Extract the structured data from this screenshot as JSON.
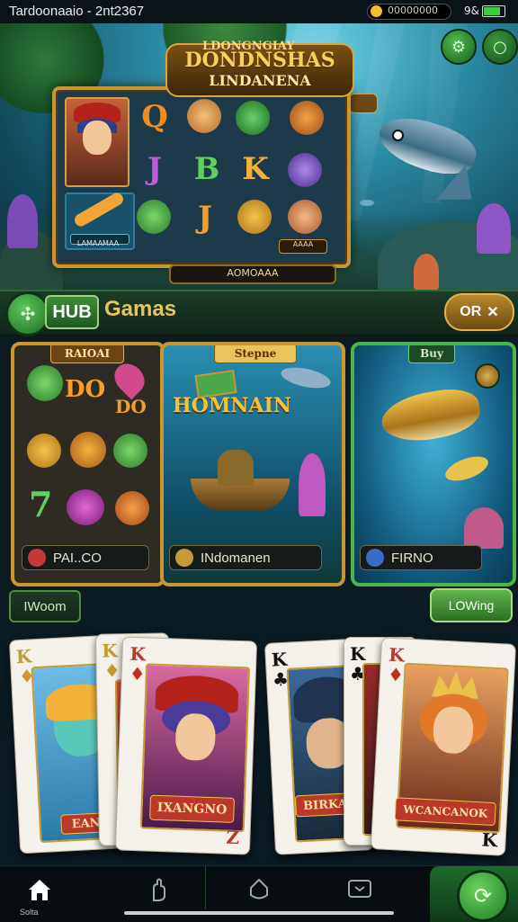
{
  "status_bar": {
    "title": "Tardoonaaio - 2nt2367",
    "balance": "00000000",
    "signal": "9&"
  },
  "hero": {
    "title_top": "LDONGNGIAY",
    "title_main": "DONDNSHAS",
    "title_sub": "LINDANENA",
    "bottom_label": "AOMOAAA",
    "reel_symbols": [
      "Q",
      "J",
      "B",
      "K",
      "J"
    ],
    "panel_labels": [
      "LAMAAMAA",
      "AAAA"
    ]
  },
  "hub": {
    "hub_label": "HUB",
    "games_label": "Gamas",
    "right_button": "OR"
  },
  "games": [
    {
      "banner": "RAIOAI",
      "caption": "PAI..CO",
      "symbol_texts": [
        "DO",
        "DO"
      ],
      "accent": "#c9962f"
    },
    {
      "banner": "Stepne",
      "caption": "INdomanen",
      "art_title": "HOMNAIN",
      "accent": "#c9962f"
    },
    {
      "banner": "Buy",
      "caption": "FIRNO",
      "accent": "#4cb54a"
    }
  ],
  "sub_actions": {
    "left": "IWoom",
    "right": "LOWing"
  },
  "cards_left": [
    {
      "rank": "K",
      "suit": "♦",
      "ribbon": "EANIE"
    },
    {
      "rank": "K",
      "suit": "♦",
      "ribbon": ""
    },
    {
      "rank": "K",
      "suit": "♦",
      "ribbon": "IXANGNO",
      "corner_bottom": "Z"
    }
  ],
  "cards_right": [
    {
      "rank": "K",
      "suit": "♣",
      "ribbon": "BIRKAN"
    },
    {
      "rank": "K",
      "suit": "♣",
      "ribbon": ""
    },
    {
      "rank": "K",
      "suit": "♦",
      "ribbon": "WCANCANOK",
      "corner_bottom": "K"
    }
  ],
  "nav": {
    "home_label": "Solta",
    "icons": [
      "home-icon",
      "hand-icon",
      "shield-icon",
      "chat-icon",
      "refresh-icon"
    ]
  },
  "colors": {
    "gold": "#c9962f",
    "green": "#4cb54a",
    "hub_bg": "#1b3d28"
  }
}
